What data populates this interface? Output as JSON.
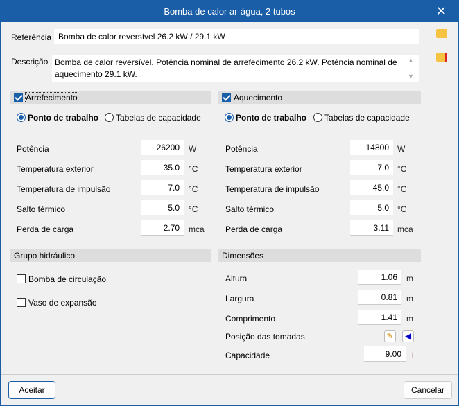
{
  "title": "Bomba de calor ar-água, 2 tubos",
  "referencia": {
    "label": "Referência",
    "value": "Bomba de calor reversível 26.2 kW / 29.1 kW"
  },
  "descricao": {
    "label": "Descrição",
    "value": "Bomba de calor reversível. Potência nominal de arrefecimento 26.2 kW. Potência nominal de aquecimento 29.1 kW."
  },
  "arrefecimento": {
    "label": "Arrefecimento",
    "checked": true,
    "radio1": "Ponto de trabalho",
    "radio2": "Tabelas de capacidade",
    "rows": [
      {
        "label": "Potência",
        "value": "26200",
        "unit": "W"
      },
      {
        "label": "Temperatura exterior",
        "value": "35.0",
        "unit": "°C"
      },
      {
        "label": "Temperatura de impulsão",
        "value": "7.0",
        "unit": "°C"
      },
      {
        "label": "Salto térmico",
        "value": "5.0",
        "unit": "°C"
      },
      {
        "label": "Perda de carga",
        "value": "2.70",
        "unit": "mca"
      }
    ]
  },
  "aquecimento": {
    "label": "Aquecimento",
    "checked": true,
    "radio1": "Ponto de trabalho",
    "radio2": "Tabelas de capacidade",
    "rows": [
      {
        "label": "Potência",
        "value": "14800",
        "unit": "W"
      },
      {
        "label": "Temperatura exterior",
        "value": "7.0",
        "unit": "°C"
      },
      {
        "label": "Temperatura de impulsão",
        "value": "45.0",
        "unit": "°C"
      },
      {
        "label": "Salto térmico",
        "value": "5.0",
        "unit": "°C"
      },
      {
        "label": "Perda de carga",
        "value": "3.11",
        "unit": "mca"
      }
    ]
  },
  "grupo": {
    "label": "Grupo hidráulico",
    "bomba": "Bomba de circulação",
    "vaso": "Vaso de expansão"
  },
  "dimensoes": {
    "label": "Dimensões",
    "altura": {
      "label": "Altura",
      "value": "1.06",
      "unit": "m"
    },
    "largura": {
      "label": "Largura",
      "value": "0.81",
      "unit": "m"
    },
    "comprimento": {
      "label": "Comprimento",
      "value": "1.41",
      "unit": "m"
    },
    "posicao": "Posição das tomadas",
    "capacidade": {
      "label": "Capacidade",
      "value": "9.00",
      "unit": "l"
    }
  },
  "buttons": {
    "ok": "Aceitar",
    "cancel": "Cancelar"
  }
}
